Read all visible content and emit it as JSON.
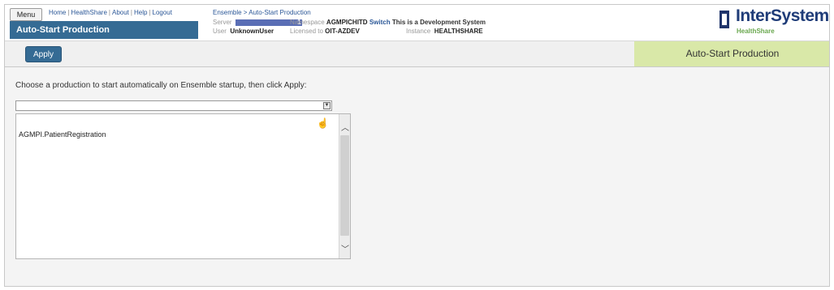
{
  "header": {
    "menu_label": "Menu",
    "links": [
      "Home",
      "HealthShare",
      "About",
      "Help",
      "Logout"
    ],
    "title": "Auto-Start Production",
    "breadcrumb": "Ensemble > Auto-Start Production",
    "server_label": "Server",
    "server_suffix": "1",
    "user_label": "User",
    "user_value": "UnknownUser",
    "namespace_label": "Namespace",
    "namespace_value": "AGMPICHITD",
    "switch_label": "Switch",
    "dev_message": "This is a Development System",
    "licensed_label": "Licensed to",
    "licensed_value": "OIT-AZDEV",
    "instance_label": "Instance",
    "instance_value": "HEALTHSHARE",
    "logo_text": "InterSystems",
    "logo_sub": "HealthShare"
  },
  "toolbar": {
    "apply_label": "Apply",
    "page_title": "Auto-Start Production"
  },
  "main": {
    "instructions": "Choose a production to start automatically on Ensemble startup, then click Apply:",
    "select_value": "",
    "list_items": [
      "AGMPI.PatientRegistration"
    ]
  },
  "colors": {
    "accent": "#356b94",
    "title_panel": "#d9e8a8",
    "logo": "#1f3c78"
  }
}
